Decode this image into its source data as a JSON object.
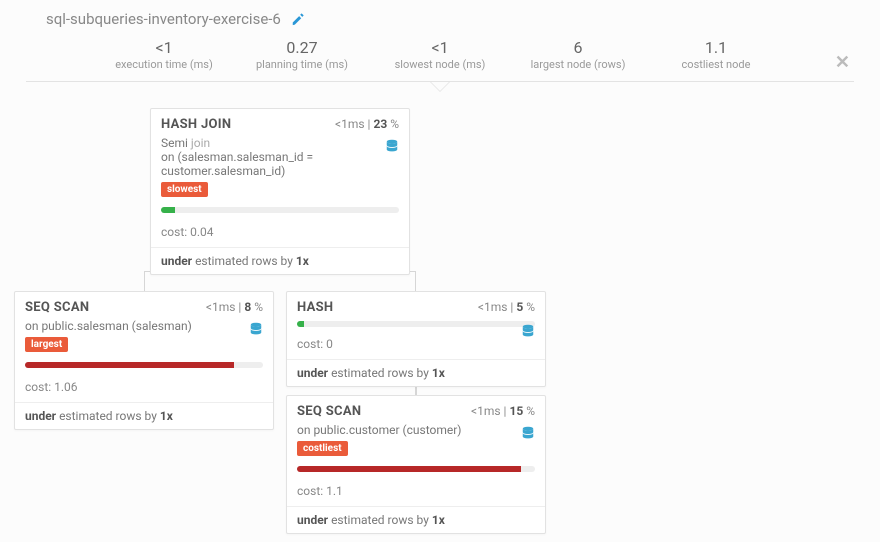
{
  "title": "sql-subqueries-inventory-exercise-6",
  "stats": [
    {
      "value": "<1",
      "label": "execution time (ms)"
    },
    {
      "value": "0.27",
      "label": "planning time (ms)"
    },
    {
      "value": "<1",
      "label": "slowest node (ms)"
    },
    {
      "value": "6",
      "label": "largest node (rows)"
    },
    {
      "value": "1.1",
      "label": "costliest node"
    }
  ],
  "nodes": {
    "hashjoin": {
      "name": "HASH JOIN",
      "time": "<1ms",
      "pct": "23",
      "desc_pre": "Semi",
      "desc_joinword": "join",
      "desc_post": "on (salesman.salesman_id = customer.salesman_id)",
      "tag": "slowest",
      "bar_pct": 6,
      "bar_color": "green",
      "cost": "0.04",
      "under_x": "1x"
    },
    "seqscan1": {
      "name": "SEQ SCAN",
      "time": "<1ms",
      "pct": "8",
      "desc": "on public.salesman (salesman)",
      "tag": "largest",
      "bar_pct": 88,
      "bar_color": "red",
      "cost": "1.06",
      "under_x": "1x"
    },
    "hash": {
      "name": "HASH",
      "time": "<1ms",
      "pct": "5",
      "bar_pct": 3,
      "bar_color": "green",
      "cost": "0",
      "under_x": "1x"
    },
    "seqscan2": {
      "name": "SEQ SCAN",
      "time": "<1ms",
      "pct": "15",
      "desc": "on public.customer (customer)",
      "tag": "costliest",
      "bar_pct": 94,
      "bar_color": "red",
      "cost": "1.1",
      "under_x": "1x"
    }
  },
  "labels": {
    "cost": "cost:",
    "under": "under",
    "estimated": "estimated rows by"
  }
}
